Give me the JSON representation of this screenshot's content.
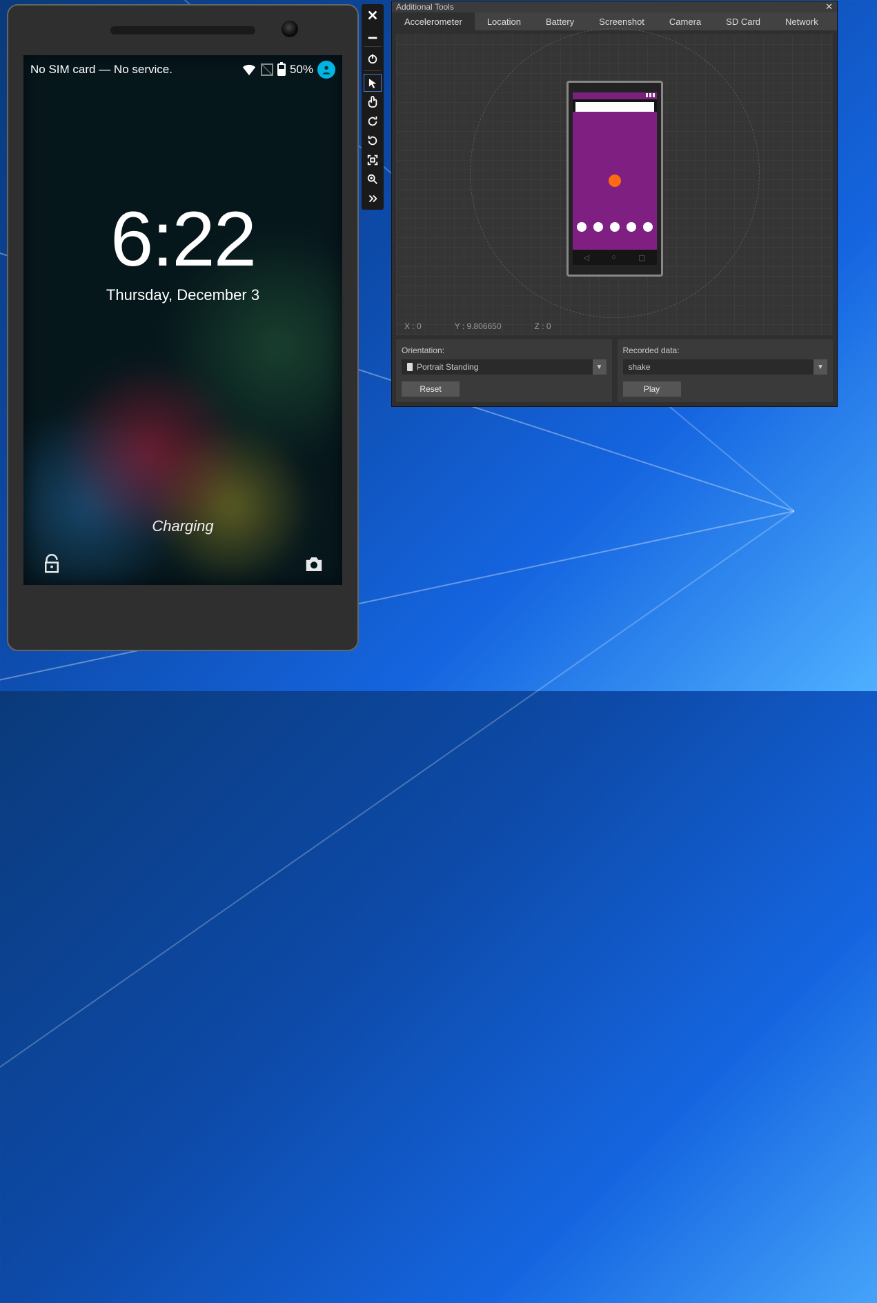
{
  "device": {
    "status_text": "No SIM card — No service.",
    "battery_percent": "50%",
    "clock_hour": "6",
    "clock_minute": "22",
    "date": "Thursday, December 3",
    "charging": "Charging"
  },
  "side_tools": [
    {
      "name": "close-icon"
    },
    {
      "name": "minimize-icon"
    },
    {
      "name": "power-icon"
    },
    {
      "name": "cursor-icon"
    },
    {
      "name": "touch-icon"
    },
    {
      "name": "rotate-left-icon"
    },
    {
      "name": "rotate-right-icon"
    },
    {
      "name": "fit-screen-icon"
    },
    {
      "name": "zoom-icon"
    },
    {
      "name": "more-icon"
    }
  ],
  "tools_window": {
    "title": "Additional Tools",
    "tabs": [
      "Accelerometer",
      "Location",
      "Battery",
      "Screenshot",
      "Camera",
      "SD Card",
      "Network"
    ],
    "active_tab": "Accelerometer",
    "coords": {
      "x": "X : 0",
      "y": "Y : 9.806650",
      "z": "Z : 0"
    },
    "orientation": {
      "label": "Orientation:",
      "value": "Portrait Standing",
      "reset": "Reset"
    },
    "recorded": {
      "label": "Recorded data:",
      "value": "shake",
      "play": "Play"
    }
  }
}
